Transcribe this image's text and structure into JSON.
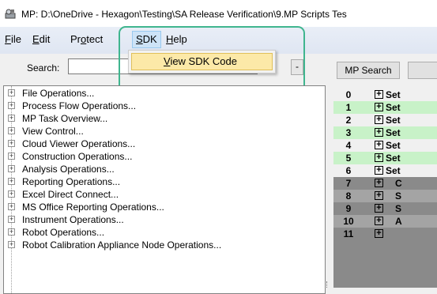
{
  "window": {
    "title": "MP: D:\\OneDrive - Hexagon\\Testing\\SA Release Verification\\9.MP Scripts Tes"
  },
  "menu": {
    "file": "File",
    "edit": "Edit",
    "protect": "Protect",
    "sdk": "SDK",
    "help": "Help"
  },
  "sdk_menu": {
    "items": [
      "View SDK Code"
    ]
  },
  "search": {
    "label": "Search:",
    "value": "",
    "dropdown_button": "-",
    "mp_search_button": "MP Search"
  },
  "tree": {
    "items": [
      "File Operations...",
      "Process Flow Operations...",
      "MP Task Overview...",
      "View Control...",
      "Cloud Viewer Operations...",
      "Construction Operations...",
      "Analysis Operations...",
      "Reporting Operations...",
      "Excel Direct Connect...",
      "MS Office Reporting Operations...",
      "Instrument Operations...",
      "Robot Operations...",
      "Robot Calibration Appliance Node Operations..."
    ]
  },
  "grid": {
    "rows": [
      {
        "num": "0",
        "text": "Set",
        "bg": "#f0f0f0"
      },
      {
        "num": "1",
        "text": "Set",
        "bg": "#c8f2c8"
      },
      {
        "num": "2",
        "text": "Set",
        "bg": "#f0f0f0"
      },
      {
        "num": "3",
        "text": "Set",
        "bg": "#c8f2c8"
      },
      {
        "num": "4",
        "text": "Set",
        "bg": "#f0f0f0"
      },
      {
        "num": "5",
        "text": "Set",
        "bg": "#c8f2c8"
      },
      {
        "num": "6",
        "text": "Set",
        "bg": "#f0f0f0"
      },
      {
        "num": "7",
        "text": "C",
        "bg": "#8a8a8a"
      },
      {
        "num": "8",
        "text": "S",
        "bg": "#a4a4a4"
      },
      {
        "num": "9",
        "text": "S",
        "bg": "#8a8a8a"
      },
      {
        "num": "10",
        "text": "A",
        "bg": "#a4a4a4"
      },
      {
        "num": "11",
        "text": "",
        "bg": "#8a8a8a"
      }
    ]
  }
}
